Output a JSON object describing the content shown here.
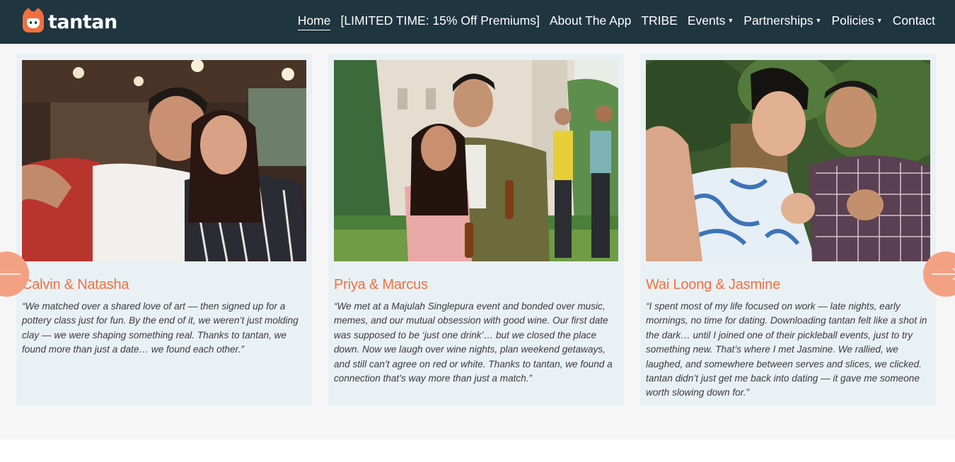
{
  "brand": {
    "name": "tantan"
  },
  "nav": {
    "items": [
      {
        "label": "Home",
        "active": true,
        "dropdown": false
      },
      {
        "label": "[LIMITED TIME: 15% Off Premiums]",
        "active": false,
        "dropdown": false
      },
      {
        "label": "About The App",
        "active": false,
        "dropdown": false
      },
      {
        "label": "TRIBE",
        "active": false,
        "dropdown": false
      },
      {
        "label": "Events",
        "active": false,
        "dropdown": true
      },
      {
        "label": "Partnerships",
        "active": false,
        "dropdown": true
      },
      {
        "label": "Policies",
        "active": false,
        "dropdown": true
      },
      {
        "label": "Contact",
        "active": false,
        "dropdown": false
      }
    ]
  },
  "testimonials": [
    {
      "name": "Calvin & Natasha",
      "quote": "“We matched over a shared love of art — then signed up for a pottery class just for fun. By the end of it, we weren’t just molding clay — we were shaping something real. Thanks to tantan, we found more than just a date… we found each other.”"
    },
    {
      "name": "Priya & Marcus",
      "quote": "“We met at a Majulah Singlepura event and  bonded over music, memes, and our mutual obsession with good wine. Our first date was supposed to be ‘just one drink’… but we closed the place down. Now we laugh over wine nights, plan weekend getaways, and still can’t agree on red or white. Thanks to tantan, we found a connection that’s way more than just a match.”"
    },
    {
      "name": "Wai Loong & Jasmine",
      "quote": "“I spent most of my life focused on work — late nights, early mornings, no time for dating. Downloading tantan felt like a shot in the dark… until I joined one of their pickleball events, just to try something new. That’s where I met Jasmine. We rallied, we laughed, and somewhere between serves and slices, we clicked. tantan didn’t just get me back into dating — it gave me someone worth slowing down for.”"
    }
  ],
  "colors": {
    "header_bg": "#1f3540",
    "accent": "#f0703f",
    "arrow_bg": "#f4a183",
    "card_bg": "#e9f1f5"
  },
  "icons": {
    "prev": "arrow-left-icon",
    "next": "arrow-right-icon"
  }
}
